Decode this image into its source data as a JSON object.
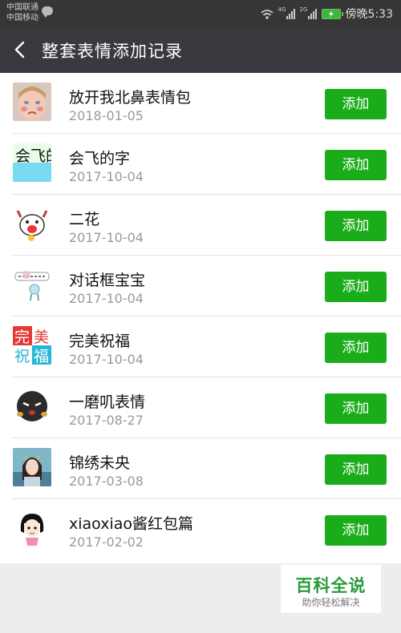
{
  "statusbar": {
    "carrier1": "中国联通",
    "carrier2": "中国移动",
    "sim1_tag": "4G",
    "sim2_tag": "2G",
    "time": "傍晚5:33"
  },
  "header": {
    "title": "整套表情添加记录"
  },
  "records": [
    {
      "name": "放开我北鼻表情包",
      "date": "2018-01-05",
      "button": "添加",
      "thumb": "baby-face-thumbnail"
    },
    {
      "name": "会飞的字",
      "date": "2017-10-04",
      "button": "添加",
      "thumb": "flying-text-thumbnail",
      "thumb_text": "会飞的字"
    },
    {
      "name": "二花",
      "date": "2017-10-04",
      "button": "添加",
      "thumb": "cow-cartoon-thumbnail"
    },
    {
      "name": "对话框宝宝",
      "date": "2017-10-04",
      "button": "添加",
      "thumb": "dialog-baby-thumbnail"
    },
    {
      "name": "完美祝福",
      "date": "2017-10-04",
      "button": "添加",
      "thumb": "perfect-blessing-thumbnail",
      "thumb_text": [
        "完",
        "美",
        "祝",
        "福"
      ]
    },
    {
      "name": "一磨叽表情",
      "date": "2017-08-27",
      "button": "添加",
      "thumb": "dark-ball-face-thumbnail"
    },
    {
      "name": "锦绣未央",
      "date": "2017-03-08",
      "button": "添加",
      "thumb": "actress-photo-thumbnail"
    },
    {
      "name": "xiaoxiao酱红包篇",
      "date": "2017-02-02",
      "button": "添加",
      "thumb": "cartoon-girl-thumbnail"
    }
  ],
  "watermark": {
    "title": "百科全说",
    "subtitle": "助你轻松解决"
  },
  "colors": {
    "accent_green": "#1aad19",
    "header_bg": "#393a3f",
    "statusbar_bg": "#363636"
  }
}
